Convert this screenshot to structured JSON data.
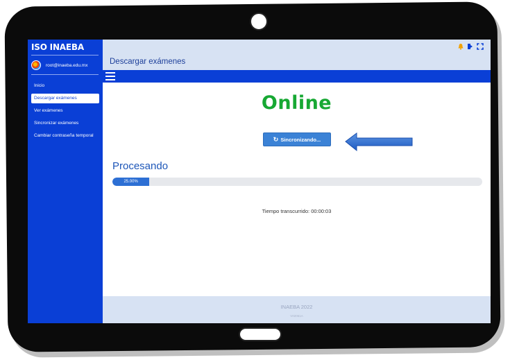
{
  "app": {
    "logo_text": "ISO INAEBA",
    "user_email": "root@inaeba.edu.mx"
  },
  "sidebar": {
    "items": [
      {
        "label": "Inicio",
        "active": false
      },
      {
        "label": "Descargar exámenes",
        "active": true
      },
      {
        "label": "Ver exámenes",
        "active": false
      },
      {
        "label": "Sincronizar exámenes",
        "active": false
      },
      {
        "label": "Cambiar contraseña temporal",
        "active": false
      }
    ]
  },
  "header": {
    "title": "Descargar exámenes",
    "icons": [
      "bell-icon",
      "logout-icon",
      "fullscreen-icon"
    ]
  },
  "main": {
    "status_word": "Online",
    "sync_button_label": "Sincronizando...",
    "heading": "Procesando",
    "progress_label": "25.00%",
    "progress_fraction": 0.25,
    "elapsed_text": "Tiempo transcurrido: 00:00:03"
  },
  "footer": {
    "text": "INAEBA 2022",
    "subtext": "V02061A"
  },
  "colors": {
    "sidebar": "#0a3fd6",
    "online_green": "#17a833",
    "button": "#3b82d6",
    "header_bg": "#d7e2f3",
    "arrow": "#2f6fd0"
  }
}
